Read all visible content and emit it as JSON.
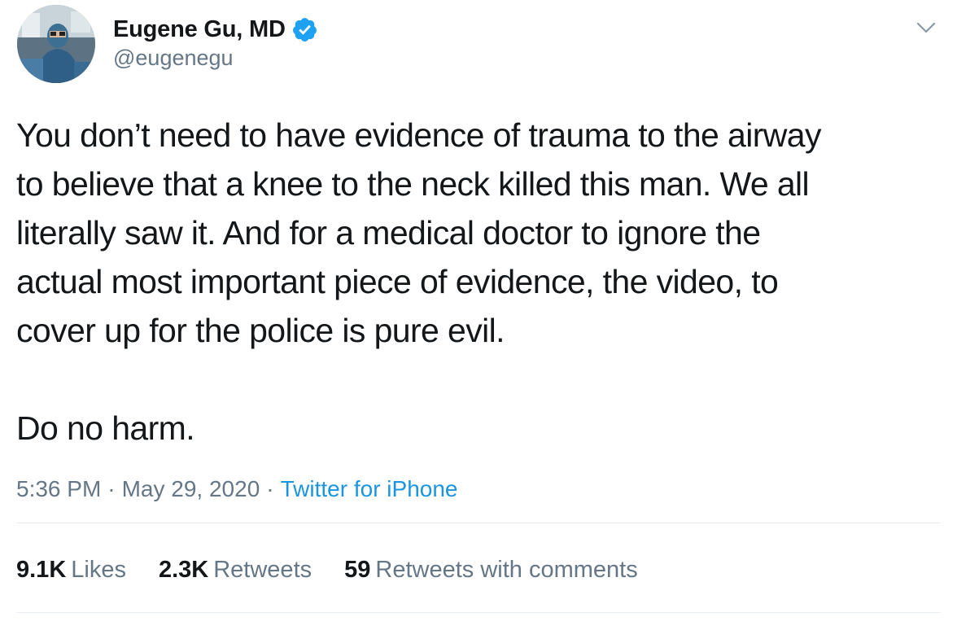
{
  "tweet": {
    "author": {
      "display_name": "Eugene Gu, MD",
      "handle": "@eugenegu",
      "verified": true,
      "verified_color": "#1da1f2",
      "avatar_icon": "avatar-surgeon-in-operating-room"
    },
    "menu_icon": "chevron-down-icon",
    "text": {
      "paragraph_1": "You don’t need to have evidence of trauma to the airway\nto believe that a knee to the neck killed this man. We all\nliterally saw it. And for a medical doctor to ignore the\nactual most important piece of evidence, the video, to\ncover up for the police is pure evil.",
      "paragraph_2": "Do no harm."
    },
    "meta": {
      "time": "5:36 PM",
      "separator_1": "·",
      "date": "May 29, 2020",
      "separator_2": "·",
      "source": "Twitter for iPhone"
    },
    "stats": {
      "likes_count": "9.1K",
      "likes_label": "Likes",
      "retweets_count": "2.3K",
      "retweets_label": "Retweets",
      "quotes_count": "59",
      "quotes_label": "Retweets with comments"
    },
    "colors": {
      "text": "#14171a",
      "secondary": "#657786",
      "link": "#1b95e0",
      "divider": "#e6ecf0"
    }
  }
}
